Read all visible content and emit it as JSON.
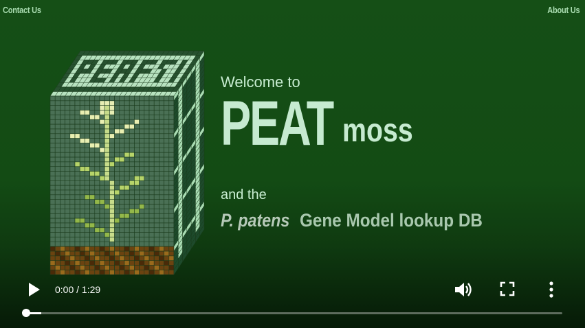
{
  "nav": {
    "contact": "Contact Us",
    "about": "About Us"
  },
  "hero": {
    "welcome": "Welcome to",
    "brand_big": "PEAT",
    "brand_small": "moss",
    "and_the": "and the",
    "species": "P. patens",
    "subtitle_rest": "Gene Model lookup DB"
  },
  "player": {
    "time": "0:00 / 1:29",
    "progress_fraction": 0.0
  },
  "icons": {
    "play": "play-icon",
    "volume": "volume-icon",
    "fullscreen": "fullscreen-icon",
    "more": "more-vertical-icon"
  },
  "colors": {
    "background": "#124a14",
    "accent": "#c6ead0",
    "soil": "#6b4310",
    "leaf": "#8fb945"
  }
}
